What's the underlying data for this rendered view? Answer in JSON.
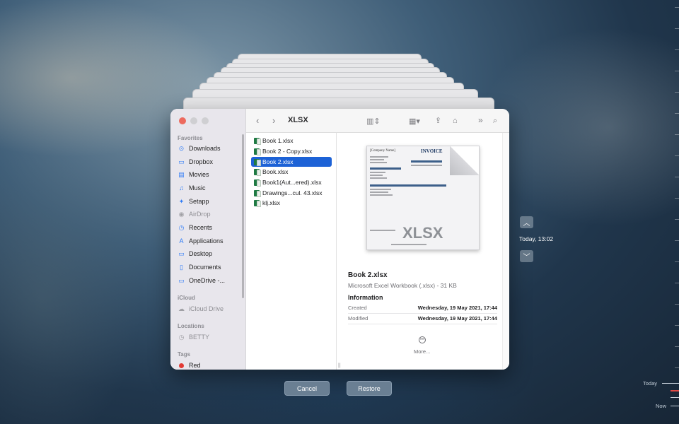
{
  "window": {
    "folder_title": "XLSX",
    "toolbar_icons": [
      "chevron-left-icon",
      "chevron-right-icon",
      "column-view-icon",
      "grid-view-icon",
      "share-icon",
      "tag-icon",
      "more-chevron-icon",
      "search-icon"
    ]
  },
  "sidebar": {
    "favorites_label": "Favorites",
    "favorites": [
      {
        "label": "Downloads",
        "icon": "download-icon"
      },
      {
        "label": "Dropbox",
        "icon": "folder-icon"
      },
      {
        "label": "Movies",
        "icon": "film-icon"
      },
      {
        "label": "Music",
        "icon": "music-icon"
      },
      {
        "label": "Setapp",
        "icon": "setapp-icon"
      },
      {
        "label": "AirDrop",
        "icon": "airdrop-icon"
      },
      {
        "label": "Recents",
        "icon": "clock-icon"
      },
      {
        "label": "Applications",
        "icon": "applications-icon"
      },
      {
        "label": "Desktop",
        "icon": "desktop-icon"
      },
      {
        "label": "Documents",
        "icon": "document-icon"
      },
      {
        "label": "OneDrive -...",
        "icon": "folder-icon"
      }
    ],
    "icloud_label": "iCloud",
    "icloud_drive": "iCloud Drive",
    "locations_label": "Locations",
    "location_betty": "BETTY",
    "tags_label": "Tags",
    "tag_red": "Red"
  },
  "files": [
    "Book 1.xlsx",
    "Book 2 - Copy.xlsx",
    "Book 2.xlsx",
    "Book.xlsx",
    "Book1(Aut...ered).xlsx",
    "Drawings...cul. 43.xlsx",
    "klj.xlsx"
  ],
  "selected_file_index": 2,
  "preview": {
    "thumbnail_company": "[Company Name]",
    "thumbnail_invoice": "INVOICE",
    "thumbnail_badge": "XLSX",
    "name": "Book 2.xlsx",
    "kind": "Microsoft Excel Workbook (.xlsx) - 31 KB",
    "info_heading": "Information",
    "created_label": "Created",
    "created_value": "Wednesday, 19 May 2021, 17:44",
    "modified_label": "Modified",
    "modified_value": "Wednesday, 19 May 2021, 17:44",
    "more_label": "More..."
  },
  "buttons": {
    "cancel": "Cancel",
    "restore": "Restore"
  },
  "time_machine": {
    "current_label": "Today, 13:02",
    "timeline_today": "Today",
    "timeline_now": "Now"
  },
  "colors": {
    "selection": "#1d62d6",
    "close_button": "#ed6a5e",
    "tag_red": "#e23b35",
    "excel_green": "#1f7a43"
  }
}
